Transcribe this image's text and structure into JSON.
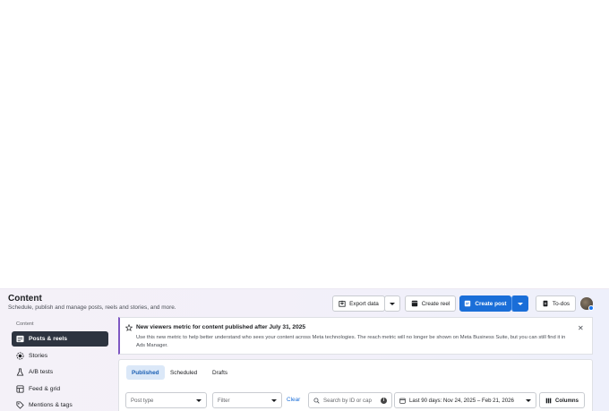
{
  "header": {
    "title": "Content",
    "subtitle": "Schedule, publish and manage posts, reels and stories, and more.",
    "export_label": "Export data",
    "create_reel_label": "Create reel",
    "create_post_label": "Create post",
    "todos_label": "To-dos"
  },
  "sidebar": {
    "section_label": "Content",
    "items": [
      {
        "label": "Posts & reels",
        "icon": "posts-icon",
        "active": true
      },
      {
        "label": "Stories",
        "icon": "stories-icon",
        "active": false
      },
      {
        "label": "A/B tests",
        "icon": "flask-icon",
        "active": false
      },
      {
        "label": "Feed & grid",
        "icon": "feed-icon",
        "active": false
      },
      {
        "label": "Mentions & tags",
        "icon": "tag-icon",
        "active": false
      }
    ]
  },
  "banner": {
    "title": "New viewers metric for content published after July 31, 2025",
    "body": "Use this new metric to help better understand who sees your content across Meta technologies. The reach metric will no longer be shown on Meta Business Suite, but you can still find it in Ads Manager."
  },
  "tabs": [
    {
      "label": "Published",
      "active": true
    },
    {
      "label": "Scheduled",
      "active": false
    },
    {
      "label": "Drafts",
      "active": false
    }
  ],
  "filters": {
    "post_type_placeholder": "Post type",
    "filter_placeholder": "Filter",
    "clear_label": "Clear",
    "search_placeholder": "Search by ID or cap",
    "date_range": "Last 90 days: Nov 24, 2025 – Feb 21, 2026",
    "columns_label": "Columns"
  },
  "colors": {
    "accent": "#1a6ed8",
    "sidebar_active": "#2d3440",
    "banner_stripe": "#7e57c2"
  }
}
